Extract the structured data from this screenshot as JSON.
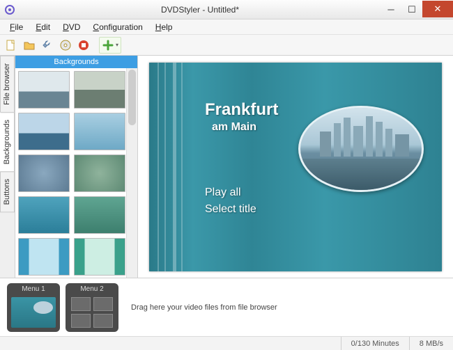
{
  "window": {
    "title": "DVDStyler - Untitled*"
  },
  "menu": {
    "file": "File",
    "edit": "Edit",
    "dvd": "DVD",
    "configuration": "Configuration",
    "help": "Help"
  },
  "side_tabs": {
    "file_browser": "File browser",
    "backgrounds": "Backgrounds",
    "buttons": "Buttons"
  },
  "panel": {
    "header": "Backgrounds"
  },
  "dvd_menu": {
    "title": "Frankfurt",
    "subtitle": "am Main",
    "play_all": "Play all",
    "select_title": "Select title"
  },
  "timeline": {
    "menu1": "Menu 1",
    "menu2": "Menu 2",
    "drag_hint": "Drag here your video files from file browser"
  },
  "status": {
    "minutes": "0/130 Minutes",
    "rate": "8 MB/s"
  },
  "icons": {
    "app": "app-icon",
    "new": "new-icon",
    "open": "open-icon",
    "save": "save-icon",
    "burn": "burn-icon",
    "stop": "stop-icon",
    "add": "add-plus-icon"
  }
}
